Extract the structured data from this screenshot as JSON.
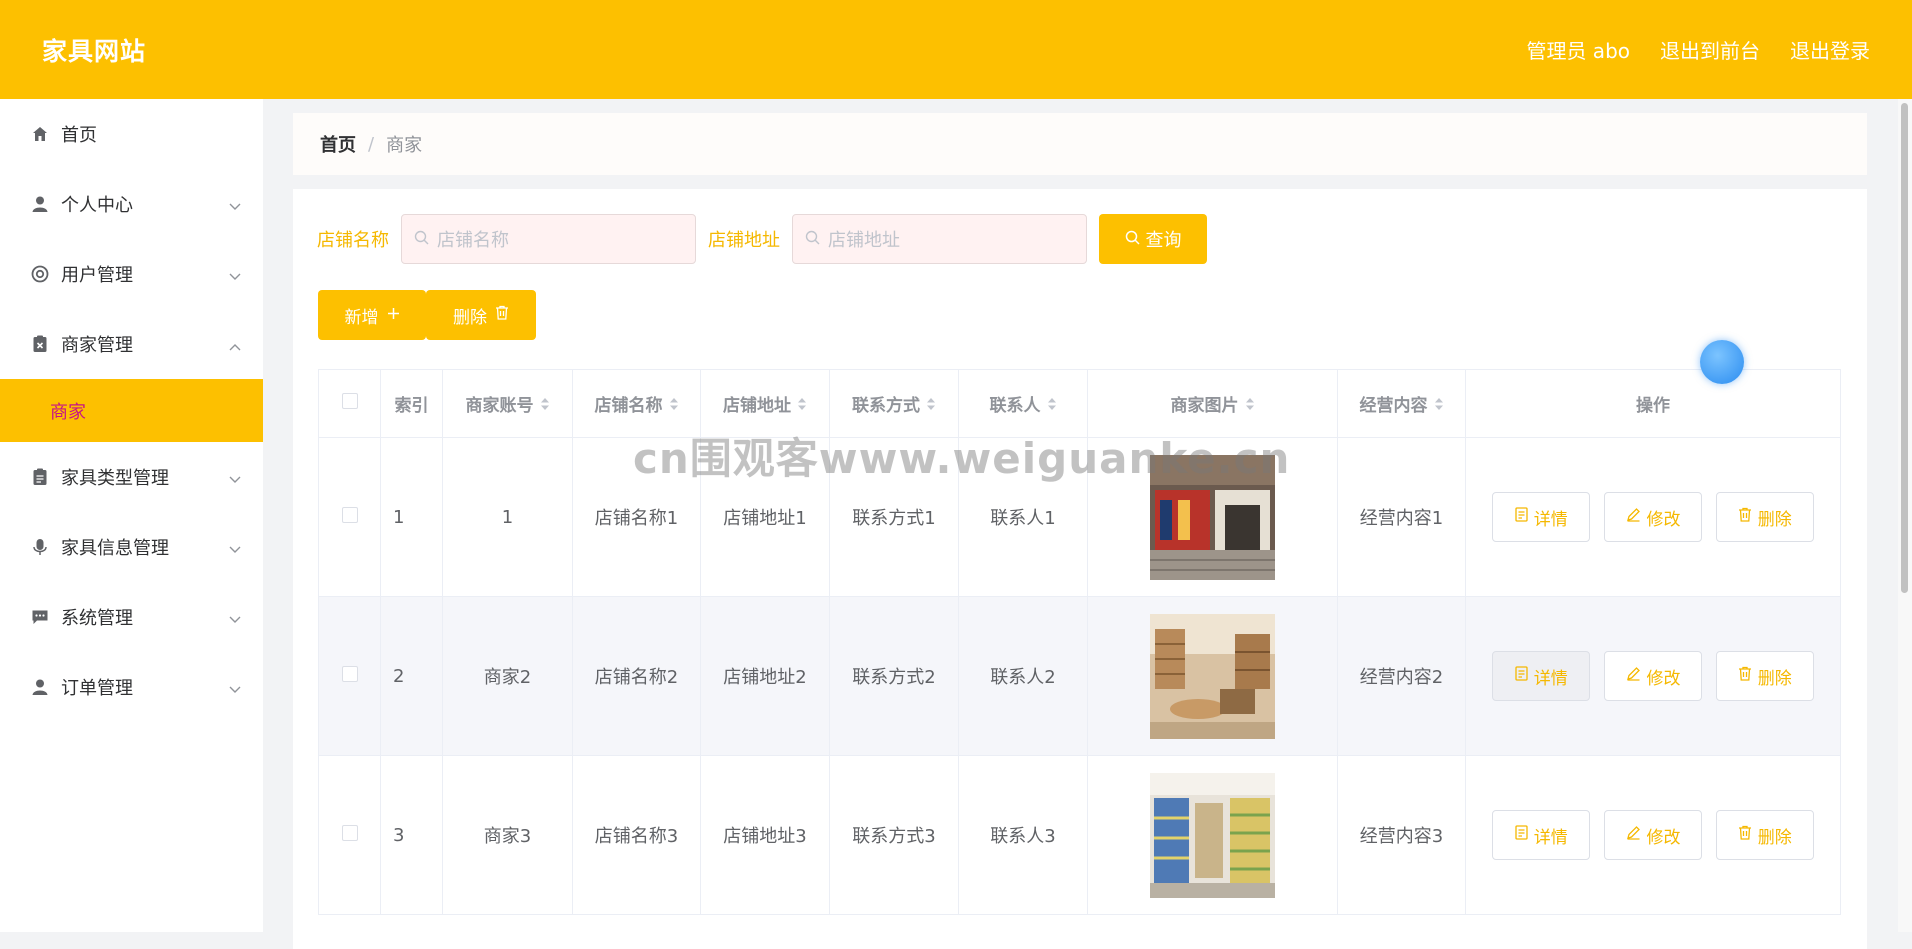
{
  "header": {
    "title": "家具网站",
    "links": [
      "管理员 abo",
      "退出到前台",
      "退出登录"
    ]
  },
  "sidebar": {
    "items": [
      {
        "label": "首页",
        "icon": "home-icon"
      },
      {
        "label": "个人中心",
        "icon": "user-icon"
      },
      {
        "label": "用户管理",
        "icon": "lifebuoy-icon"
      },
      {
        "label": "商家管理",
        "icon": "clipboard-x-icon"
      },
      {
        "label": "家具类型管理",
        "icon": "clipboard-icon"
      },
      {
        "label": "家具信息管理",
        "icon": "mic-icon"
      },
      {
        "label": "系统管理",
        "icon": "chat-icon"
      },
      {
        "label": "订单管理",
        "icon": "user-icon"
      }
    ],
    "active_sub": "商家"
  },
  "breadcrumb": {
    "home": "首页",
    "current": "商家"
  },
  "search": {
    "shop_name_label": "店铺名称",
    "shop_name_placeholder": "店铺名称",
    "shop_addr_label": "店铺地址",
    "shop_addr_placeholder": "店铺地址",
    "button": "查询"
  },
  "actions": {
    "add": "新增",
    "delete": "删除"
  },
  "table": {
    "headers": [
      "索引",
      "商家账号",
      "店铺名称",
      "店铺地址",
      "联系方式",
      "联系人",
      "商家图片",
      "经营内容",
      "操作"
    ],
    "rows": [
      {
        "index": "1",
        "account": "1",
        "name": "店铺名称1",
        "addr": "店铺地址1",
        "contact": "联系方式1",
        "person": "联系人1",
        "content": "经营内容1"
      },
      {
        "index": "2",
        "account": "商家2",
        "name": "店铺名称2",
        "addr": "店铺地址2",
        "contact": "联系方式2",
        "person": "联系人2",
        "content": "经营内容2"
      },
      {
        "index": "3",
        "account": "商家3",
        "name": "店铺名称3",
        "addr": "店铺地址3",
        "contact": "联系方式3",
        "person": "联系人3",
        "content": "经营内容3"
      }
    ],
    "row_actions": {
      "detail": "详情",
      "edit": "修改",
      "delete": "删除"
    }
  },
  "watermark": "cn围观客www.weiguanke.cn",
  "colors": {
    "brand": "#fdc000",
    "accent_text": "#f5b800",
    "active_sub_text": "#c71585"
  }
}
